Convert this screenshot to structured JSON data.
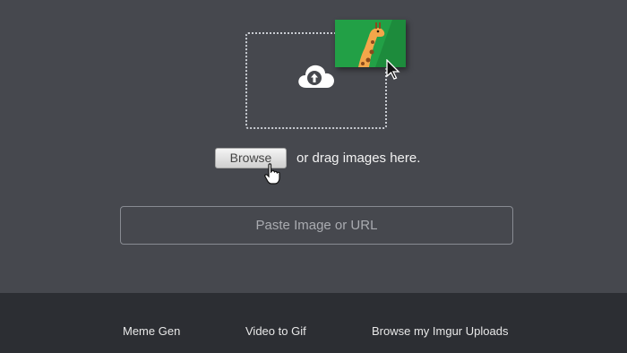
{
  "upload": {
    "browse_label": "Browse",
    "drag_text": "or drag images here.",
    "paste_placeholder": "Paste Image or URL",
    "upload_icon": "cloud-upload-icon",
    "thumbnail_icon": "giraffe-image-icon"
  },
  "footer": {
    "links": [
      {
        "label": "Meme Gen"
      },
      {
        "label": "Video to Gif"
      },
      {
        "label": "Browse my Imgur Uploads"
      }
    ]
  },
  "colors": {
    "background": "#46484e",
    "footer": "#2c2e33",
    "thumbnail": "#22a046"
  }
}
